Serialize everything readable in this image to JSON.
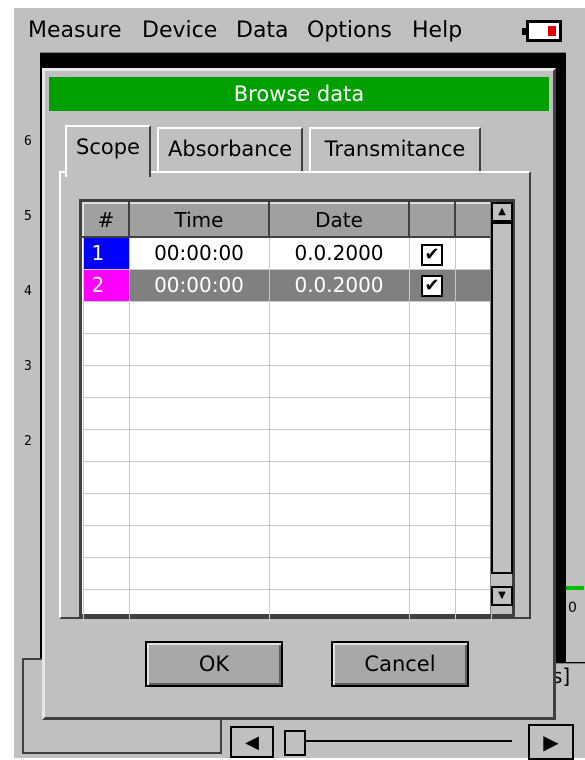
{
  "menubar": {
    "items": [
      "Measure",
      "Device",
      "Data",
      "Options",
      "Help"
    ]
  },
  "plot": {
    "y_ticks": [
      "6",
      "5",
      "4",
      "3",
      "2"
    ],
    "x_tick_end": "0",
    "x_unit_fragment": "s]",
    "bracket": "["
  },
  "dialog": {
    "title": "Browse data",
    "tabs": [
      "Scope",
      "Absorbance",
      "Transmitance"
    ],
    "active_tab": "Scope",
    "table": {
      "headers": [
        "#",
        "Time",
        "Date",
        "",
        ""
      ],
      "rows": [
        {
          "num": "1",
          "num_color": "#0000ff",
          "time": "00:00:00",
          "date": "0.0.2000",
          "checked": true,
          "selected": false
        },
        {
          "num": "2",
          "num_color": "#ff00ff",
          "time": "00:00:00",
          "date": "0.0.2000",
          "checked": true,
          "selected": true
        }
      ],
      "empty_rows": 10
    },
    "ok_label": "OK",
    "cancel_label": "Cancel"
  },
  "colors": {
    "title_bar": "#00a000",
    "battery_level": "#e00000"
  }
}
